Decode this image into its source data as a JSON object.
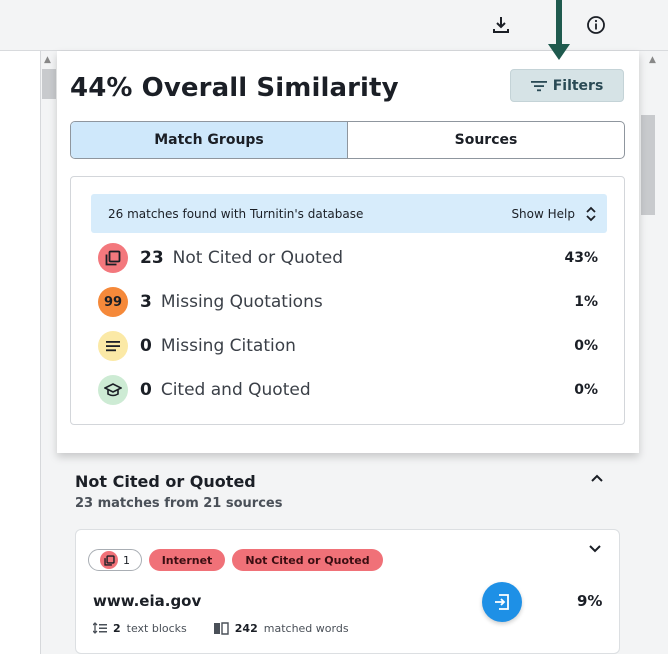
{
  "toolbar": {
    "download_icon": "download-icon",
    "info_icon": "info-icon"
  },
  "panel": {
    "title": "44% Overall Similarity",
    "filters_label": "Filters",
    "tabs": [
      {
        "label": "Match Groups",
        "active": true
      },
      {
        "label": "Sources",
        "active": false
      }
    ]
  },
  "summary": {
    "info_text": "26 matches found with Turnitin's database",
    "help_label": "Show Help",
    "categories": [
      {
        "count": "23",
        "label": "Not Cited or Quoted",
        "pct": "43%",
        "icon": "copy-icon",
        "color": "#f3787d"
      },
      {
        "count": "3",
        "label": "Missing Quotations",
        "pct": "1%",
        "icon": "quote-icon",
        "color": "#f5893a"
      },
      {
        "count": "0",
        "label": "Missing Citation",
        "pct": "0%",
        "icon": "lines-icon",
        "color": "#fbe9a6"
      },
      {
        "count": "0",
        "label": "Cited and Quoted",
        "pct": "0%",
        "icon": "graduation-cap-icon",
        "color": "#cdebd4"
      }
    ]
  },
  "group": {
    "title": "Not Cited or Quoted",
    "subtitle": "23 matches from 21 sources",
    "card": {
      "count_pill": "1",
      "tag_internet": "Internet",
      "tag_category": "Not Cited or Quoted",
      "source": "www.eia.gov",
      "pct": "9%",
      "blocks_count": "2",
      "blocks_label": "text blocks",
      "words_count": "242",
      "words_label": "matched words"
    }
  },
  "colors": {
    "accent": "#1e90e6",
    "tag_red": "#f07178",
    "tab_active": "#cfe8fb",
    "arrow": "#1f5a4e"
  }
}
